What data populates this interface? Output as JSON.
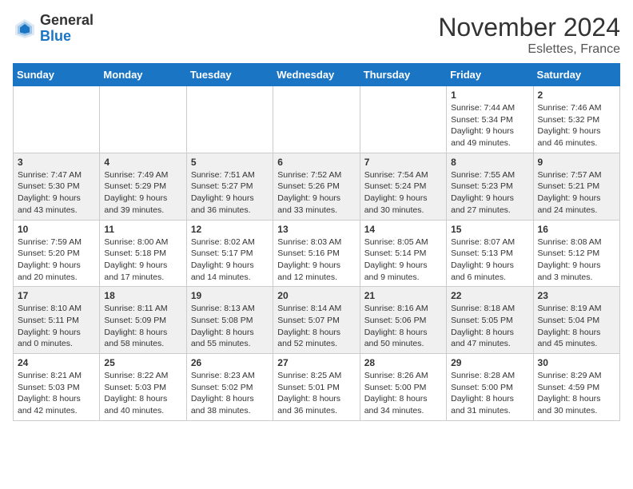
{
  "logo": {
    "general": "General",
    "blue": "Blue"
  },
  "header": {
    "month": "November 2024",
    "location": "Eslettes, France"
  },
  "days_of_week": [
    "Sunday",
    "Monday",
    "Tuesday",
    "Wednesday",
    "Thursday",
    "Friday",
    "Saturday"
  ],
  "weeks": [
    [
      {
        "day": "",
        "info": ""
      },
      {
        "day": "",
        "info": ""
      },
      {
        "day": "",
        "info": ""
      },
      {
        "day": "",
        "info": ""
      },
      {
        "day": "",
        "info": ""
      },
      {
        "day": "1",
        "info": "Sunrise: 7:44 AM\nSunset: 5:34 PM\nDaylight: 9 hours and 49 minutes."
      },
      {
        "day": "2",
        "info": "Sunrise: 7:46 AM\nSunset: 5:32 PM\nDaylight: 9 hours and 46 minutes."
      }
    ],
    [
      {
        "day": "3",
        "info": "Sunrise: 7:47 AM\nSunset: 5:30 PM\nDaylight: 9 hours and 43 minutes."
      },
      {
        "day": "4",
        "info": "Sunrise: 7:49 AM\nSunset: 5:29 PM\nDaylight: 9 hours and 39 minutes."
      },
      {
        "day": "5",
        "info": "Sunrise: 7:51 AM\nSunset: 5:27 PM\nDaylight: 9 hours and 36 minutes."
      },
      {
        "day": "6",
        "info": "Sunrise: 7:52 AM\nSunset: 5:26 PM\nDaylight: 9 hours and 33 minutes."
      },
      {
        "day": "7",
        "info": "Sunrise: 7:54 AM\nSunset: 5:24 PM\nDaylight: 9 hours and 30 minutes."
      },
      {
        "day": "8",
        "info": "Sunrise: 7:55 AM\nSunset: 5:23 PM\nDaylight: 9 hours and 27 minutes."
      },
      {
        "day": "9",
        "info": "Sunrise: 7:57 AM\nSunset: 5:21 PM\nDaylight: 9 hours and 24 minutes."
      }
    ],
    [
      {
        "day": "10",
        "info": "Sunrise: 7:59 AM\nSunset: 5:20 PM\nDaylight: 9 hours and 20 minutes."
      },
      {
        "day": "11",
        "info": "Sunrise: 8:00 AM\nSunset: 5:18 PM\nDaylight: 9 hours and 17 minutes."
      },
      {
        "day": "12",
        "info": "Sunrise: 8:02 AM\nSunset: 5:17 PM\nDaylight: 9 hours and 14 minutes."
      },
      {
        "day": "13",
        "info": "Sunrise: 8:03 AM\nSunset: 5:16 PM\nDaylight: 9 hours and 12 minutes."
      },
      {
        "day": "14",
        "info": "Sunrise: 8:05 AM\nSunset: 5:14 PM\nDaylight: 9 hours and 9 minutes."
      },
      {
        "day": "15",
        "info": "Sunrise: 8:07 AM\nSunset: 5:13 PM\nDaylight: 9 hours and 6 minutes."
      },
      {
        "day": "16",
        "info": "Sunrise: 8:08 AM\nSunset: 5:12 PM\nDaylight: 9 hours and 3 minutes."
      }
    ],
    [
      {
        "day": "17",
        "info": "Sunrise: 8:10 AM\nSunset: 5:11 PM\nDaylight: 9 hours and 0 minutes."
      },
      {
        "day": "18",
        "info": "Sunrise: 8:11 AM\nSunset: 5:09 PM\nDaylight: 8 hours and 58 minutes."
      },
      {
        "day": "19",
        "info": "Sunrise: 8:13 AM\nSunset: 5:08 PM\nDaylight: 8 hours and 55 minutes."
      },
      {
        "day": "20",
        "info": "Sunrise: 8:14 AM\nSunset: 5:07 PM\nDaylight: 8 hours and 52 minutes."
      },
      {
        "day": "21",
        "info": "Sunrise: 8:16 AM\nSunset: 5:06 PM\nDaylight: 8 hours and 50 minutes."
      },
      {
        "day": "22",
        "info": "Sunrise: 8:18 AM\nSunset: 5:05 PM\nDaylight: 8 hours and 47 minutes."
      },
      {
        "day": "23",
        "info": "Sunrise: 8:19 AM\nSunset: 5:04 PM\nDaylight: 8 hours and 45 minutes."
      }
    ],
    [
      {
        "day": "24",
        "info": "Sunrise: 8:21 AM\nSunset: 5:03 PM\nDaylight: 8 hours and 42 minutes."
      },
      {
        "day": "25",
        "info": "Sunrise: 8:22 AM\nSunset: 5:03 PM\nDaylight: 8 hours and 40 minutes."
      },
      {
        "day": "26",
        "info": "Sunrise: 8:23 AM\nSunset: 5:02 PM\nDaylight: 8 hours and 38 minutes."
      },
      {
        "day": "27",
        "info": "Sunrise: 8:25 AM\nSunset: 5:01 PM\nDaylight: 8 hours and 36 minutes."
      },
      {
        "day": "28",
        "info": "Sunrise: 8:26 AM\nSunset: 5:00 PM\nDaylight: 8 hours and 34 minutes."
      },
      {
        "day": "29",
        "info": "Sunrise: 8:28 AM\nSunset: 5:00 PM\nDaylight: 8 hours and 31 minutes."
      },
      {
        "day": "30",
        "info": "Sunrise: 8:29 AM\nSunset: 4:59 PM\nDaylight: 8 hours and 30 minutes."
      }
    ]
  ]
}
